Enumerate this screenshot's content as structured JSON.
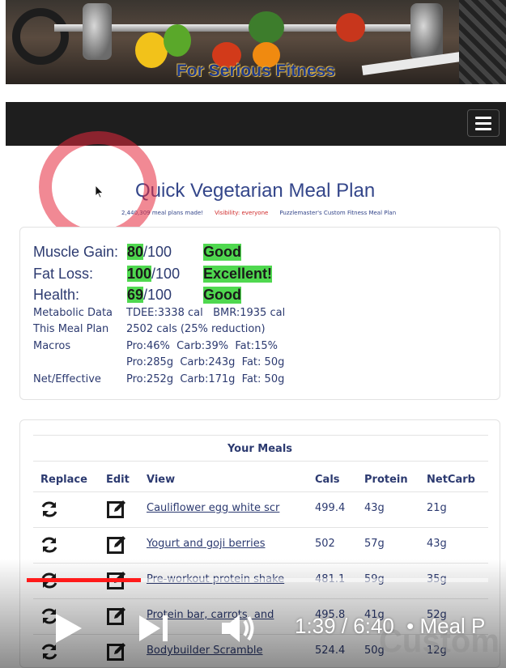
{
  "banner": {
    "title": "For Serious Fitness"
  },
  "header": {
    "page_title": "Quick Vegetarian Meal Plan",
    "plans_made": "2,440,309 meal plans made!",
    "visibility": "Visibility: everyone",
    "custom_plan": "Puzzlemaster's Custom Fitness Meal Plan"
  },
  "scores": [
    {
      "label": "Muscle Gain:",
      "value": "80",
      "max": "/100",
      "grade": "Good"
    },
    {
      "label": "Fat Loss:",
      "value": "100",
      "max": "/100",
      "grade": "Excellent!"
    },
    {
      "label": "Health:",
      "value": "69",
      "max": "/100",
      "grade": "Good"
    }
  ],
  "info": [
    {
      "label": "Metabolic Data",
      "value": "TDEE:3338 cal   BMR:1935 cal"
    },
    {
      "label": "This Meal Plan",
      "value": "2502 cals (25% reduction)"
    },
    {
      "label": "Macros",
      "value": "Pro:46%  Carb:39%  Fat:15%"
    },
    {
      "label": "",
      "value": "Pro:285g  Carb:243g  Fat: 50g"
    },
    {
      "label": "Net/Effective",
      "value": "Pro:252g  Carb:171g  Fat: 50g"
    }
  ],
  "meals": {
    "title": "Your Meals",
    "columns": {
      "replace": "Replace",
      "edit": "Edit",
      "view": "View",
      "cals": "Cals",
      "protein": "Protein",
      "netcarb": "NetCarb"
    },
    "rows": [
      {
        "name": "Cauliflower egg white scr",
        "cals": "499.4",
        "protein": "43g",
        "netcarb": "21g"
      },
      {
        "name": "Yogurt and goji berries",
        "cals": "502",
        "protein": "57g",
        "netcarb": "43g"
      },
      {
        "name": "Pre-workout protein shake",
        "cals": "481.1",
        "protein": "59g",
        "netcarb": "35g"
      },
      {
        "name": "Protein bar, carrots, and",
        "cals": "495.8",
        "protein": "41g",
        "netcarb": "52g"
      },
      {
        "name": "Bodybuilder Scramble",
        "cals": "524.4",
        "protein": "50g",
        "netcarb": "12g"
      }
    ]
  },
  "video": {
    "time": "1:39 / 6:40",
    "chapter": "• Meal P",
    "progress_fraction": 0.248,
    "watermark": "Custom",
    "played_color": "#ff1a1a"
  },
  "colors": {
    "accent": "#34468a",
    "grade_bg": "#4fd84f",
    "navbar": "#1e1e1e"
  }
}
